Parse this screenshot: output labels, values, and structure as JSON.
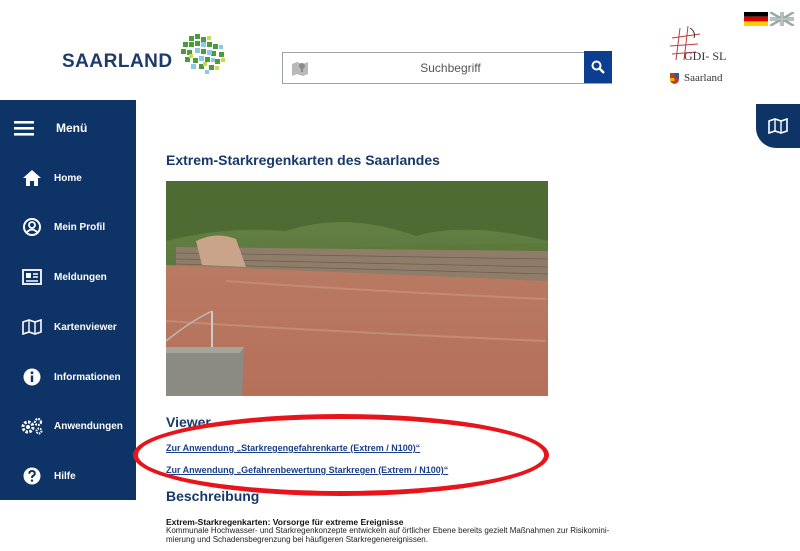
{
  "header": {
    "logo_text": "SAARLAND",
    "search_placeholder": "Suchbegriff",
    "gdi_label": "GDI- SL",
    "gdi_sub": "Saarland",
    "language_flags": [
      "flag-de-icon",
      "flag-uk-icon"
    ]
  },
  "sidebar": {
    "menu_label": "Menü",
    "items": [
      {
        "label": "Home",
        "icon": "home-icon"
      },
      {
        "label": "Mein Profil",
        "icon": "user-icon"
      },
      {
        "label": "Meldungen",
        "icon": "news-icon"
      },
      {
        "label": "Kartenviewer",
        "icon": "map-icon"
      },
      {
        "label": "Informationen",
        "icon": "info-icon"
      },
      {
        "label": "Anwendungen",
        "icon": "gears-icon"
      },
      {
        "label": "Hilfe",
        "icon": "help-icon"
      }
    ]
  },
  "main": {
    "title": "Extrem-Starkregenkarten des Saarlandes",
    "viewer_heading": "Viewer",
    "links": [
      "Zur Anwendung „Starkregengefahrenkarte (Extrem / N100)“",
      "Zur Anwendung „Gefahrenbewertung Starkregen (Extrem / N100)“"
    ],
    "description_heading": "Beschreibung",
    "description_subheading": "Extrem-Starkregenkarten: Vorsorge für extreme Ereignisse",
    "description_line1": "Kommunale Hochwasser- und Starkregenkonzepte entwickeln auf örtlicher Ebene bereits gezielt Maßnahmen zur Risikomini-",
    "description_line2": "mierung und Schadensbegrenzung bei häufigeren Starkregenereignissen."
  },
  "colors": {
    "sidebar": "#0e3366",
    "heading": "#17386a",
    "link": "#1a3f8a",
    "highlight": "#e8141b",
    "search_button": "#0b3d91"
  }
}
